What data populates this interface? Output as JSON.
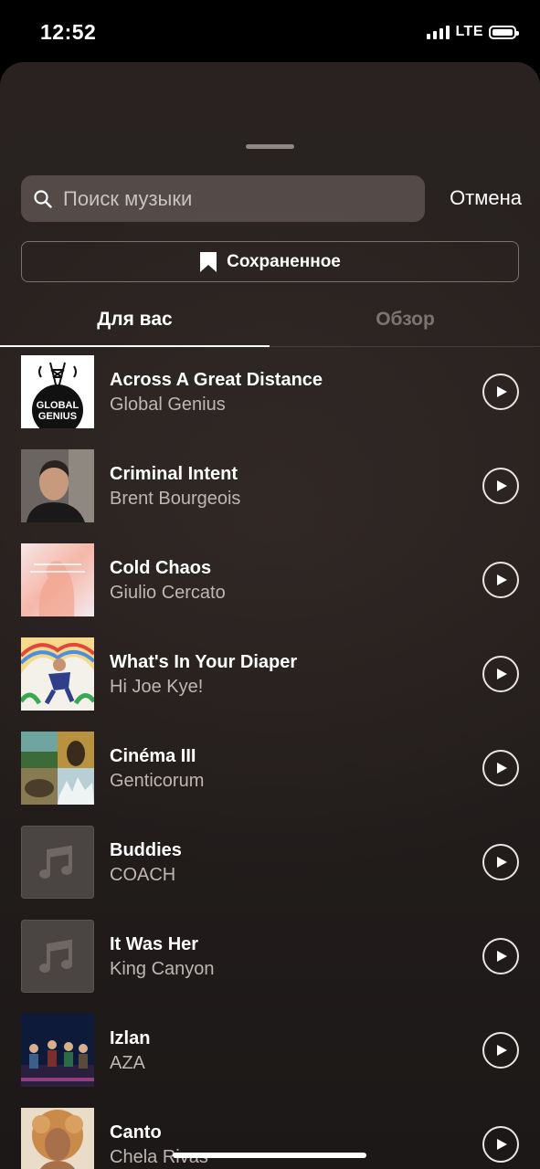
{
  "status_bar": {
    "time": "12:52",
    "network": "LTE"
  },
  "search": {
    "placeholder": "Поиск музыки",
    "cancel_label": "Отмена"
  },
  "saved_label": "Сохраненное",
  "tabs": [
    {
      "label": "Для вас",
      "active": true
    },
    {
      "label": "Обзор",
      "active": false
    }
  ],
  "tracks": [
    {
      "title": "Across A Great Distance",
      "artist": "Global Genius",
      "cover_text": "GLOBAL GENIUS"
    },
    {
      "title": "Criminal Intent",
      "artist": "Brent Bourgeois"
    },
    {
      "title": "Cold Chaos",
      "artist": "Giulio Cercato"
    },
    {
      "title": "What's In Your Diaper",
      "artist": "Hi Joe Kye!"
    },
    {
      "title": "Cinéma III",
      "artist": "Genticorum"
    },
    {
      "title": "Buddies",
      "artist": "COACH"
    },
    {
      "title": "It Was Her",
      "artist": "King Canyon"
    },
    {
      "title": "Izlan",
      "artist": "AZA"
    },
    {
      "title": "Canto",
      "artist": "Chela Rivas"
    }
  ]
}
